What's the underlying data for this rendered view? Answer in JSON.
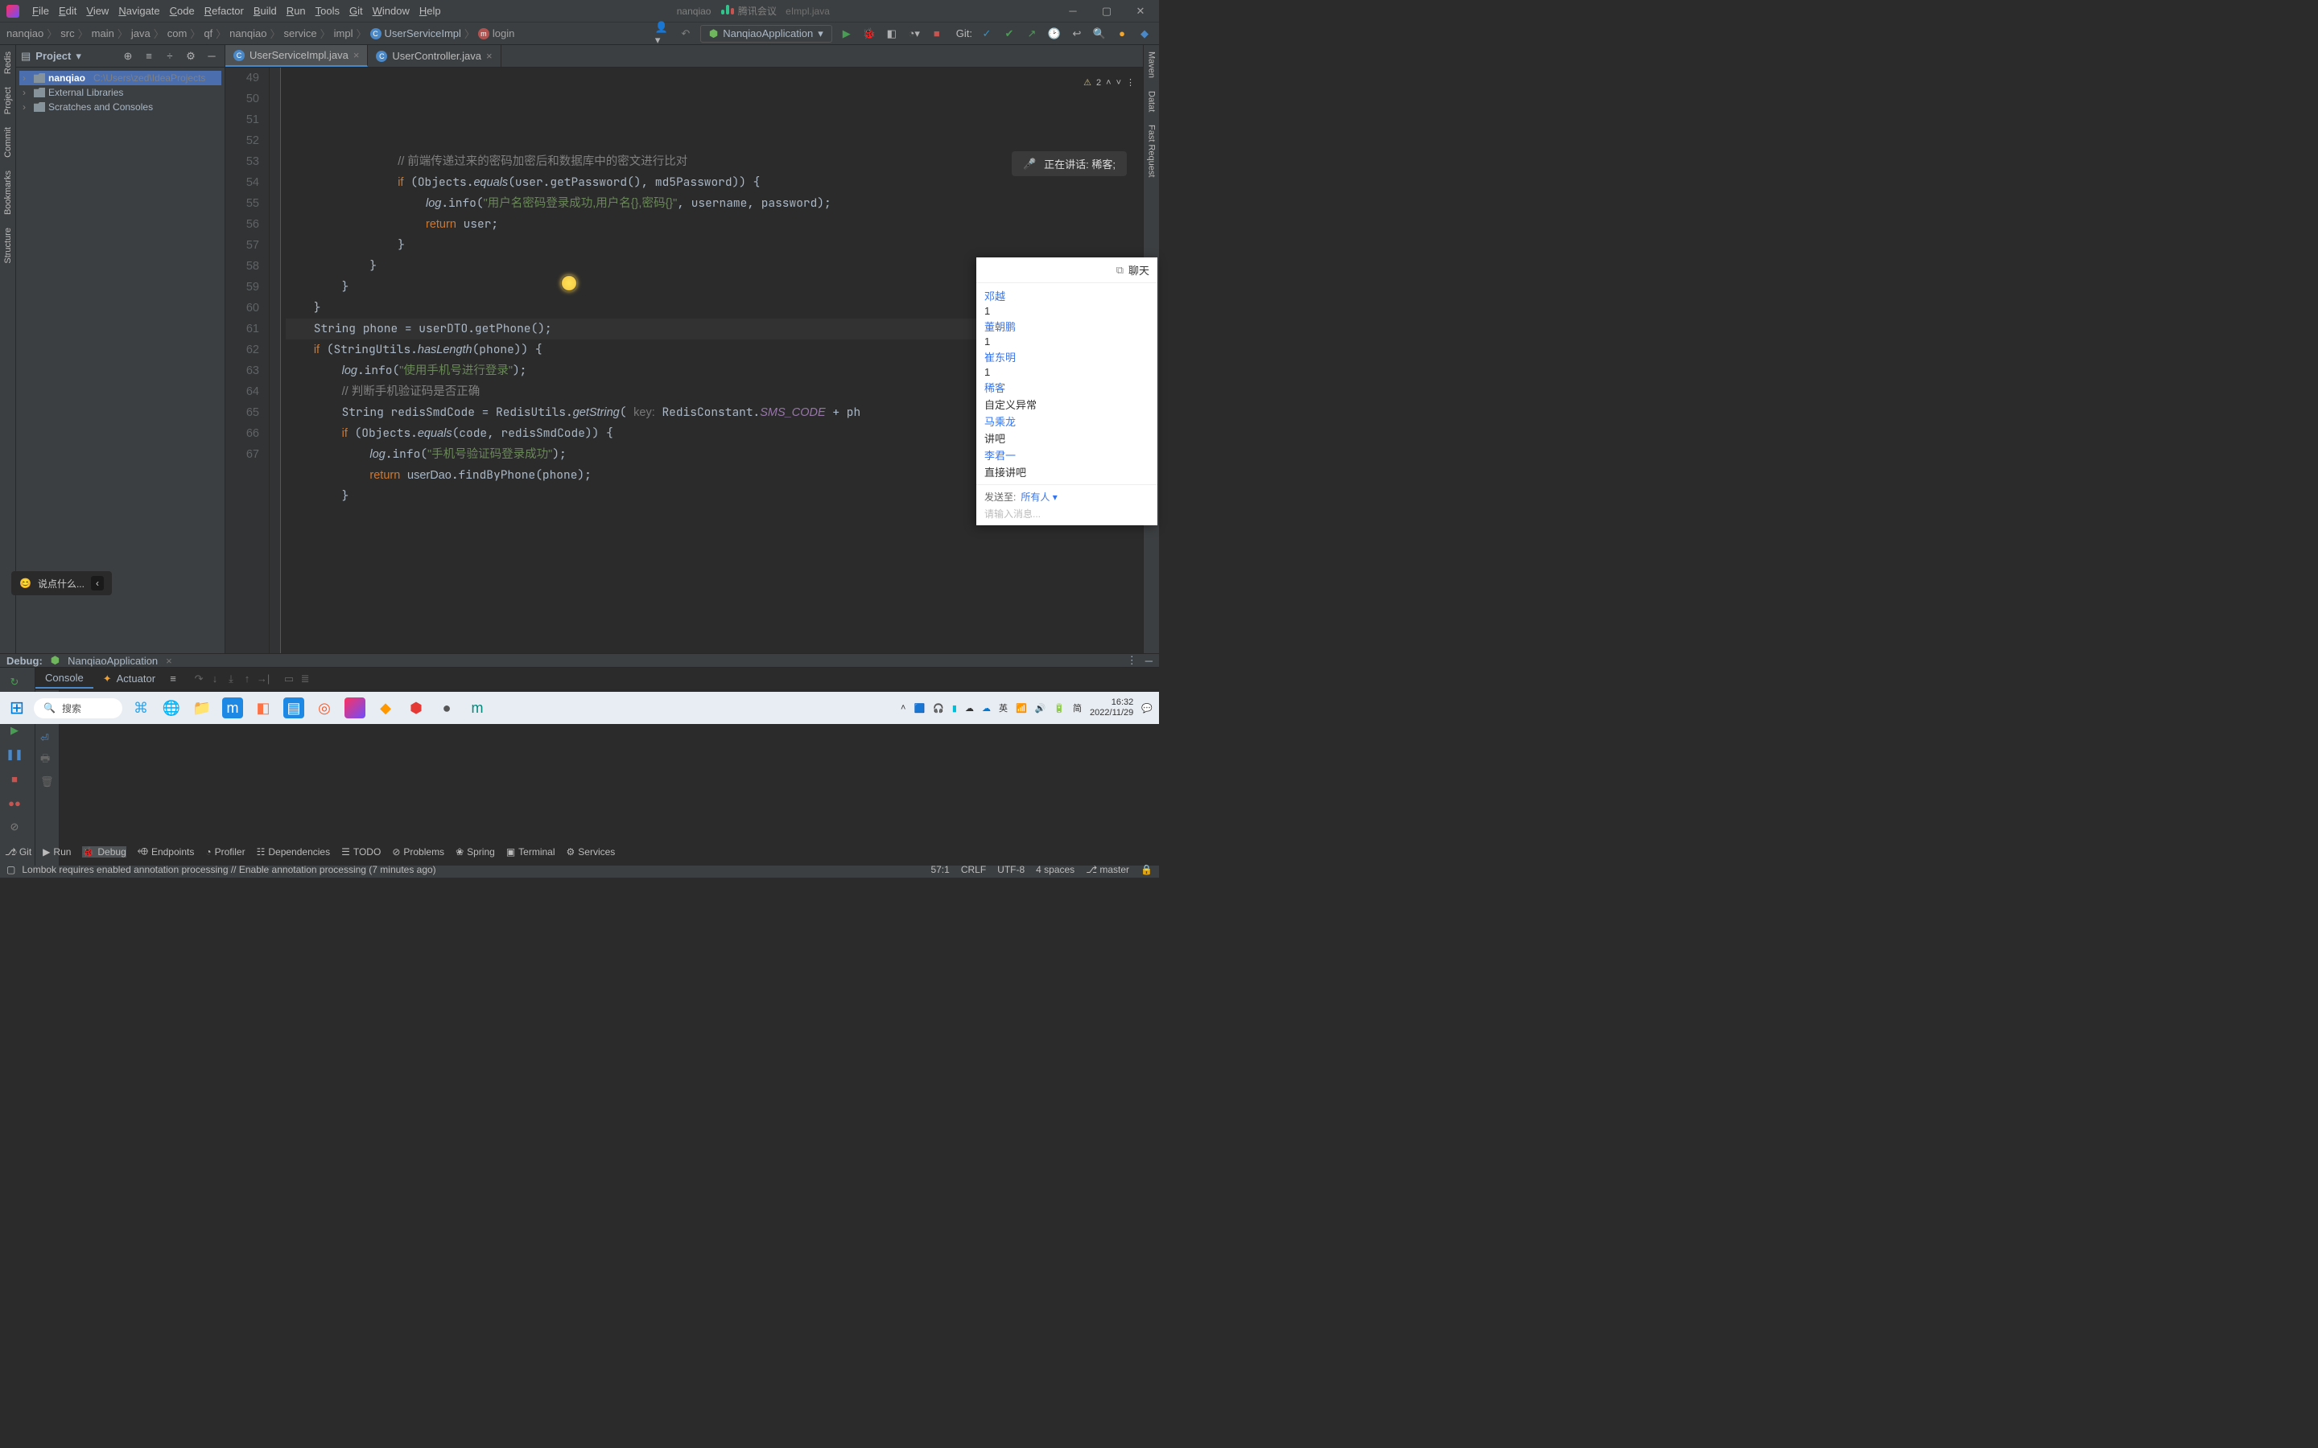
{
  "menubar": [
    "File",
    "Edit",
    "View",
    "Navigate",
    "Code",
    "Refactor",
    "Build",
    "Run",
    "Tools",
    "Git",
    "Window",
    "Help"
  ],
  "title_path": "nanqiao",
  "meeting_app": "腾讯会议",
  "title_file": "eImpl.java",
  "breadcrumbs": [
    "nanqiao",
    "src",
    "main",
    "java",
    "com",
    "qf",
    "nanqiao",
    "service",
    "impl",
    "UserServiceImpl",
    "login"
  ],
  "run_config": "NanqiaoApplication",
  "git_label": "Git:",
  "left_gutter_tabs": [
    "Redis",
    "Project",
    "Commit",
    "Bookmarks",
    "Structure"
  ],
  "right_gutter_tabs": [
    "Maven",
    "Datat",
    "Fast Request"
  ],
  "project": {
    "title": "Project",
    "rows": [
      {
        "icon": "module",
        "text": "nanqiao",
        "hint": "C:\\Users\\zed\\IdeaProjects",
        "sel": true
      },
      {
        "icon": "lib",
        "text": "External Libraries"
      },
      {
        "icon": "scratch",
        "text": "Scratches and Consoles"
      }
    ]
  },
  "tabs": [
    {
      "label": "UserServiceImpl.java",
      "active": true,
      "icon": "C"
    },
    {
      "label": "UserController.java",
      "active": false,
      "icon": "C"
    }
  ],
  "inspection_warn": "2",
  "code": {
    "start": 49,
    "lines": [
      {
        "n": 49,
        "html": "                <span class='com'>// 前端传递过来的密码加密后和数据库中的密文进行比对</span>"
      },
      {
        "n": 50,
        "html": "                <span class='kw'>if</span> (Objects.<span class='it'>equals</span>(user.getPassword(), md5Password)) {"
      },
      {
        "n": 51,
        "html": "                    <span class='it'>log</span>.info(<span class='str'>\"用户名密码登录成功,用户名{},密码{}\"</span>, username, password);"
      },
      {
        "n": 52,
        "html": "                    <span class='kw'>return</span> user;"
      },
      {
        "n": 53,
        "html": "                }"
      },
      {
        "n": 54,
        "html": "            }"
      },
      {
        "n": 55,
        "html": "        }"
      },
      {
        "n": 56,
        "html": "    }"
      },
      {
        "n": 57,
        "html": "    String phone = userDTO.getPhone();",
        "hl": true
      },
      {
        "n": 58,
        "html": "    <span class='kw'>if</span> (StringUtils.<span class='it'>hasLength</span>(phone)) {"
      },
      {
        "n": 59,
        "html": "        <span class='it'>log</span>.info(<span class='str'>\"使用手机号进行登录\"</span>);"
      },
      {
        "n": 60,
        "html": "        <span class='com'>// 判断手机验证码是否正确</span>"
      },
      {
        "n": 61,
        "html": "        String redisSmdCode = RedisUtils.<span class='it'>getString</span>( <span class='param-hint'>key:</span> RedisConstant.<span class='const-ref'>SMS_CODE</span> + ph"
      },
      {
        "n": 62,
        "html": "        <span class='kw'>if</span> (Objects.<span class='it'>equals</span>(code, redisSmdCode)) {"
      },
      {
        "n": 63,
        "html": "            <span class='it'>log</span>.info(<span class='str'>\"手机号验证码登录成功\"</span>);"
      },
      {
        "n": 64,
        "html": "            <span class='kw'>return</span> <span class=''>userDao</span>.findByPhone(phone);"
      },
      {
        "n": 65,
        "html": "        }"
      },
      {
        "n": 66,
        "html": ""
      },
      {
        "n": 67,
        "html": "    "
      }
    ]
  },
  "debug": {
    "label": "Debug:",
    "target": "NanqiaoApplication",
    "tabs": [
      "Console",
      "Actuator"
    ]
  },
  "bottom_tools": [
    "Git",
    "Run",
    "Debug",
    "Endpoints",
    "Profiler",
    "Dependencies",
    "TODO",
    "Problems",
    "Spring",
    "Terminal",
    "Services"
  ],
  "status_msg": "Lombok requires enabled annotation processing // Enable annotation processing (7 minutes ago)",
  "status_right": {
    "pos": "57:1",
    "eol": "CRLF",
    "enc": "UTF-8",
    "indent": "4 spaces",
    "branch": "master"
  },
  "speaking": {
    "prefix": "正在讲话:",
    "name": "稀客;"
  },
  "speak_bubble": "说点什么...",
  "chat": {
    "title": "聊天",
    "messages": [
      {
        "name": "邓越",
        "text": ""
      },
      {
        "name": "",
        "text": "1"
      },
      {
        "name": "董朝鹏",
        "text": ""
      },
      {
        "name": "",
        "text": "1"
      },
      {
        "name": "崔东明",
        "text": ""
      },
      {
        "name": "",
        "text": "1"
      },
      {
        "name": "稀客",
        "text": ""
      },
      {
        "name": "",
        "text": "自定义异常"
      },
      {
        "name": "马乘龙",
        "text": ""
      },
      {
        "name": "",
        "text": "讲吧"
      },
      {
        "name": "李君一",
        "text": ""
      },
      {
        "name": "",
        "text": "直接讲吧"
      }
    ],
    "send_label": "发送至:",
    "send_target": "所有人",
    "placeholder": "请输入消息..."
  },
  "taskbar": {
    "search_placeholder": "搜索",
    "time": "16:32",
    "date": "2022/11/29",
    "ime": "英",
    "ime2": "简"
  }
}
